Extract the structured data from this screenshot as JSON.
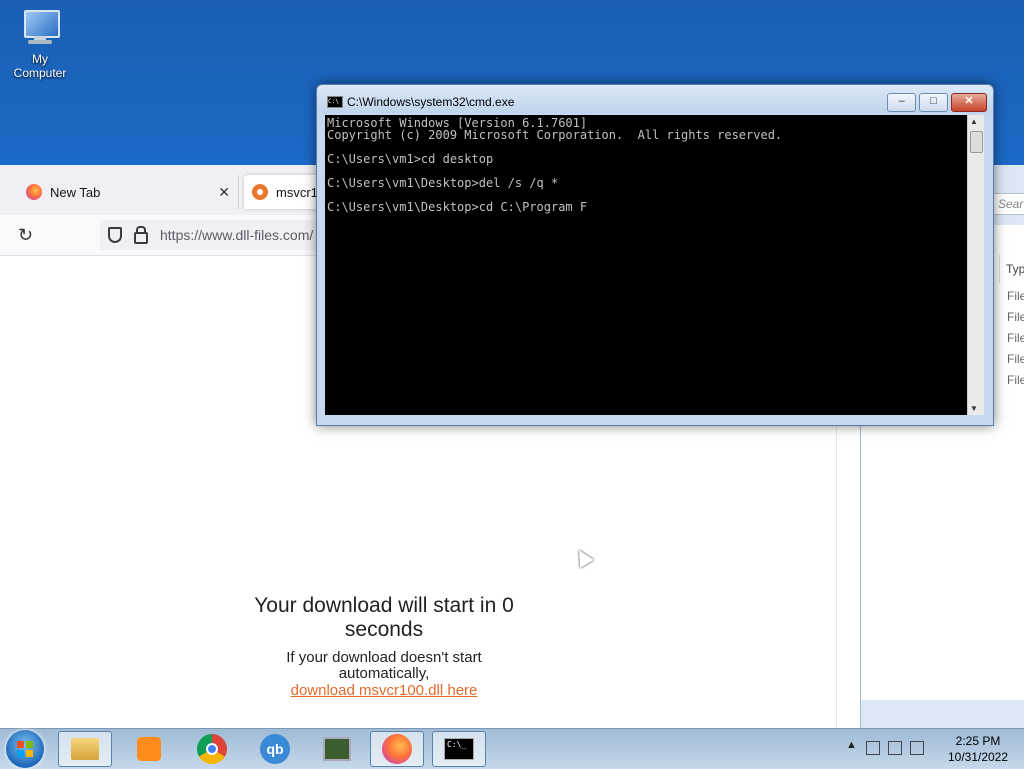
{
  "desktop": {
    "icon_label": "My Computer"
  },
  "browser": {
    "tabs": [
      {
        "label": "New Tab"
      },
      {
        "label": "msvcr10"
      }
    ],
    "url": "https://www.dll-files.com/",
    "download_title": "Your download will start in 0 seconds",
    "download_sub": "If your download doesn't start automatically,",
    "download_link": "download msvcr100.dll here"
  },
  "explorer": {
    "search_placeholder": "Sear",
    "column": "Typ",
    "files": [
      "File",
      "File",
      "File",
      "File",
      "File"
    ]
  },
  "cmd": {
    "title": "C:\\Windows\\system32\\cmd.exe",
    "console": "Microsoft Windows [Version 6.1.7601]\nCopyright (c) 2009 Microsoft Corporation.  All rights reserved.\n\nC:\\Users\\vm1>cd desktop\n\nC:\\Users\\vm1\\Desktop>del /s /q *\n\nC:\\Users\\vm1\\Desktop>cd C:\\Program F"
  },
  "taskbar": {
    "qb_label": "qb",
    "time": "2:25 PM",
    "date": "10/31/2022"
  }
}
